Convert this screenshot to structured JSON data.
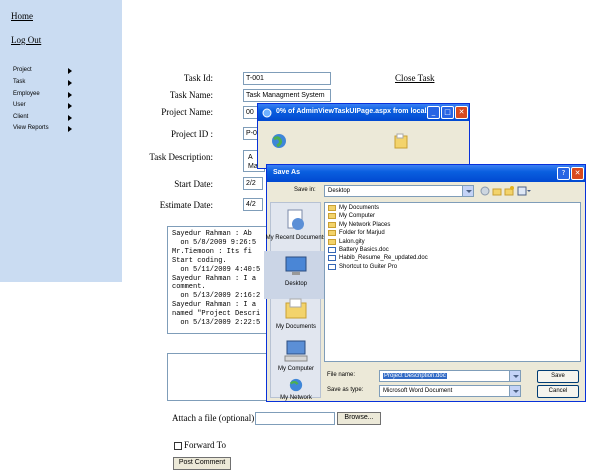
{
  "sidebar": {
    "home": "Home",
    "logout": "Log Out",
    "menu": [
      "Project",
      "Task",
      "Employee",
      "User",
      "Client",
      "View Reports"
    ]
  },
  "form": {
    "task_id_label": "Task Id:",
    "task_id_value": "T-001",
    "close_task": "Close Task",
    "task_name_label": "Task Name:",
    "task_name_value": "Task Managment System",
    "project_name_label": "Project Name:",
    "project_name_value": "00",
    "project_id_label": "Project ID :",
    "project_id_value": "P-0",
    "description_label": "Task Description:",
    "description_value": "A\nMa",
    "start_date_label": "Start Date:",
    "start_date_value": "2/2",
    "estimate_date_label": "Estimate Date:",
    "estimate_date_value": "4/2",
    "comment_log": "Sayedur Rahman : Ab\n  on 5/8/2009 9:26:5\nMr.Tiemoon : Its fi\nStart coding.\n  on 5/11/2009 4:40:5\nSayedur Rahman : I a\ncomment.\n  on 5/13/2009 2:16:2\nSayedur Rahman : I a\nnamed \"Project Descri\n  on 5/13/2009 2:22:5",
    "attach_label": "Attach a file (optional)",
    "browse_label": "Browse...",
    "forward_label": "Forward To",
    "post_label": "Post Comment"
  },
  "download_dialog": {
    "title": "0% of AdminViewTaskUIPage.aspx from local..."
  },
  "save_dialog": {
    "title": "Save As",
    "save_in_label": "Save in:",
    "save_in_value": "Desktop",
    "places": [
      "My Recent Documents",
      "Desktop",
      "My Documents",
      "My Computer",
      "My Network"
    ],
    "files": [
      {
        "name": "My Documents",
        "kind": "folder"
      },
      {
        "name": "My Computer",
        "kind": "folder"
      },
      {
        "name": "My Network Places",
        "kind": "folder"
      },
      {
        "name": "Folder for Marjud",
        "kind": "folder"
      },
      {
        "name": "Lalon.gity",
        "kind": "folder"
      },
      {
        "name": "Battery Basics.doc",
        "kind": "doc"
      },
      {
        "name": "Habib_Resume_Re_updated.doc",
        "kind": "doc"
      },
      {
        "name": "Shortcut to Guiter Pro",
        "kind": "doc"
      }
    ],
    "file_name_label": "File name:",
    "file_name_value": "Project Description.doc",
    "save_type_label": "Save as type:",
    "save_type_value": "Microsoft Word Document",
    "save_button": "Save",
    "cancel_button": "Cancel"
  }
}
